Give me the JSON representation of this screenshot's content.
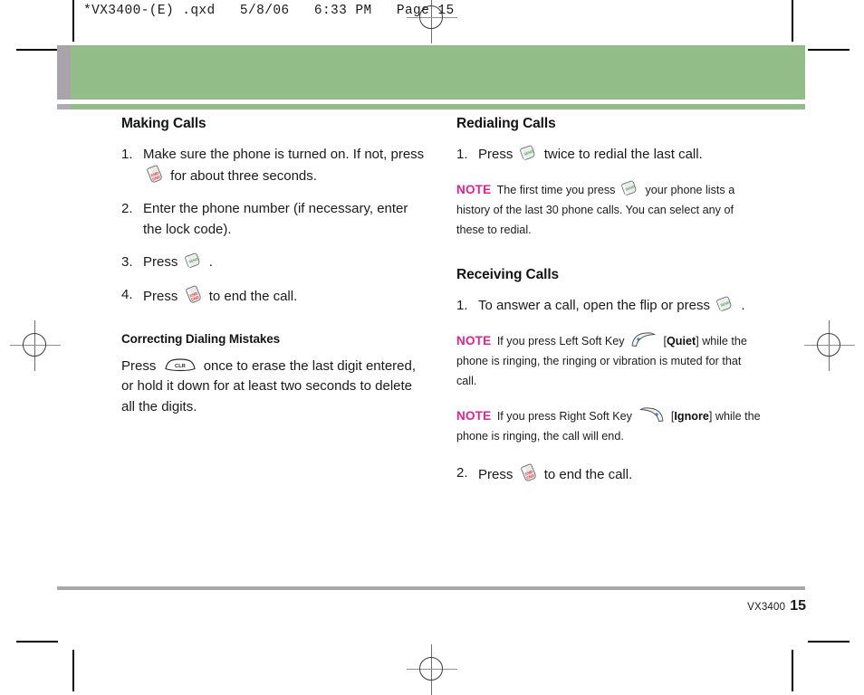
{
  "scan_header": "*VX3400-(E) .qxd   5/8/06   6:33 PM   Page 15",
  "colors": {
    "banner_green": "#93bd88",
    "banner_tab_gray": "#a9a4ab",
    "note_magenta": "#e5218f",
    "send_green": "#3faa4e",
    "end_red": "#e03030",
    "softkey_dot_blue": "#2f7fd6",
    "footer_rule_gray": "#a8a8a8"
  },
  "icons": {
    "end_key": {
      "name": "end-key-icon",
      "label": "END"
    },
    "send_key": {
      "name": "send-key-icon",
      "label": "SEND"
    },
    "clr_key": {
      "name": "clr-key-icon",
      "label": "CLR"
    },
    "left_soft_key": {
      "name": "left-soft-key-icon",
      "label": "Left Soft Key"
    },
    "right_soft_key": {
      "name": "right-soft-key-icon",
      "label": "Right Soft Key"
    }
  },
  "left_column": {
    "heading": "Making Calls",
    "steps": [
      {
        "num": "1.",
        "text_before": "Make sure the phone is turned on. If not, press",
        "text_after": "for about three seconds."
      },
      {
        "num": "2.",
        "text_before": "Enter the phone number (if necessary, enter the lock code).",
        "text_after": ""
      },
      {
        "num": "3.",
        "text_before": "Press",
        "text_after": "."
      },
      {
        "num": "4.",
        "text_before": "Press",
        "text_after": "to end the call."
      }
    ],
    "subheading": "Correcting Dialing Mistakes",
    "paragraph_before": "Press",
    "paragraph_after": "once to erase the last digit entered, or hold it down for at least two seconds to delete all the digits."
  },
  "right_column": {
    "heading_redialing": "Redialing Calls",
    "redial_step": {
      "num": "1.",
      "text_before": "Press",
      "text_after": "twice to redial the last call."
    },
    "note_redial": {
      "label": "NOTE",
      "text_before": "The first time you press",
      "text_after": "your phone lists a history of the last 30 phone calls. You can select any of these to redial."
    },
    "heading_receiving": "Receiving Calls",
    "receive_step_1": {
      "num": "1.",
      "text_before": "To answer a call, open the flip or press",
      "text_after": "."
    },
    "note_quiet": {
      "label": "NOTE",
      "text_before": "If you press Left Soft Key",
      "bracket_open": "[",
      "bold": "Quiet",
      "bracket_close": "]",
      "text_after": "while the phone is ringing, the ringing or vibration is muted for that call."
    },
    "note_ignore": {
      "label": "NOTE",
      "text_before": "If you press Right Soft Key",
      "bracket_open": "[",
      "bold": "Ignore",
      "bracket_close": "]",
      "text_after": "while the phone is ringing, the call will end."
    },
    "receive_step_2": {
      "num": "2.",
      "text_before": "Press",
      "text_after": "to end the call."
    }
  },
  "footer": {
    "model": "VX3400",
    "page_number": "15"
  }
}
